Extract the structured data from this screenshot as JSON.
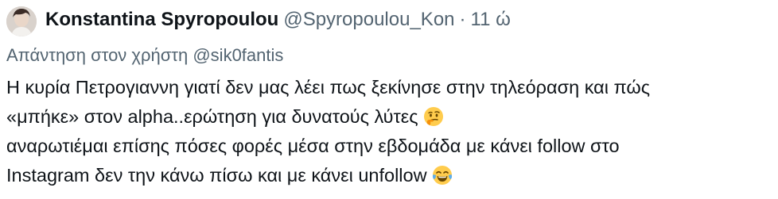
{
  "tweet": {
    "author": {
      "display_name": "Konstantina Spyropoulou",
      "handle": "@Spyropoulou_Kon",
      "separator": "·",
      "time": "11 ώ"
    },
    "reply": {
      "prefix": "Απάντηση στον χρήστη",
      "mention": "@sik0fantis"
    },
    "body_lines": [
      "Η κυρία Πετρογιαννη γιατί δεν μας λέει πως ξεκίνησε στην τηλεόραση και πώς",
      "«μπήκε» στον alpha..ερώτηση για δυνατούς λύτες",
      "αναρωτιέμαι επίσης πόσες φορές μέσα στην εβδομάδα με κάνει follow στο",
      "Instagram δεν την κάνω πίσω και με κάνει unfollow"
    ],
    "emojis": {
      "line2": "thinking-face",
      "line4": "face-with-tears-of-joy"
    }
  }
}
